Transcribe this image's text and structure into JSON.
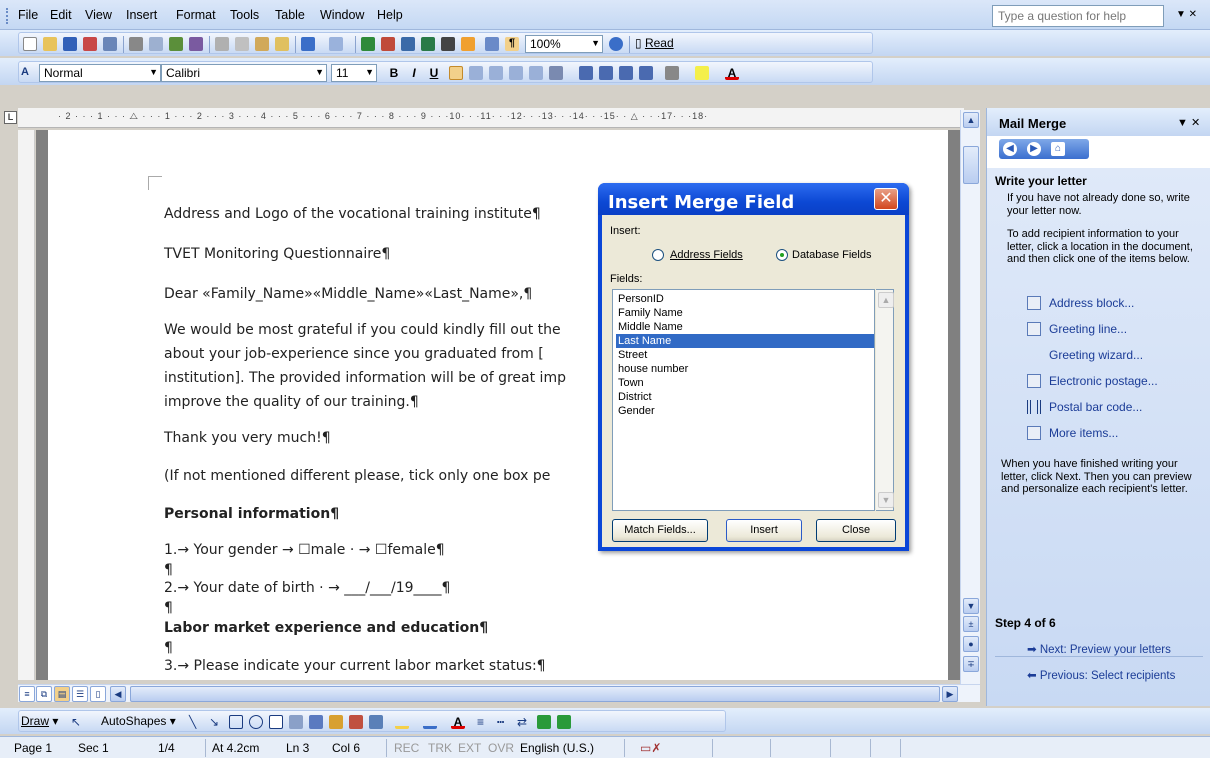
{
  "menu": {
    "items": [
      "File",
      "Edit",
      "View",
      "Insert",
      "Format",
      "Tools",
      "Table",
      "Window",
      "Help"
    ],
    "help_placeholder": "Type a question for help"
  },
  "standard_toolbar": {
    "zoom": "100%",
    "read_label": "Read"
  },
  "formatting_toolbar": {
    "style": "Normal",
    "font": "Calibri",
    "size": "11",
    "bold": "B",
    "italic": "I",
    "underline": "U"
  },
  "ruler": {
    "marks": "· 2 · · · 1 · · · ⧍ · · · 1 · · · 2 · · · 3 · · · 4 · · · 5 · · · 6 · · · 7 · · · 8 · · · 9 · · ·10· · ·11· · ·12· · ·13· · ·14· · ·15· · △ · · ·17· · ·18·",
    "corner": "L"
  },
  "document": {
    "p1": "Address and Logo of the vocational training institute¶",
    "p2": "TVET Monitoring Questionnaire¶",
    "p3": "Dear «Family_Name»«Middle_Name»«Last_Name»,¶",
    "p4a": "We would be most grateful if you could kindly fill out the",
    "p4b": "about your job-experience since you graduated from [",
    "p4c": "institution]. The provided information will be of great imp",
    "p4d": "improve the quality of our training.¶",
    "p5": "Thank you very much!¶",
    "p6": "(If not mentioned different please, tick only one box pe",
    "p7": "Personal information¶",
    "p8": "1.→ Your gender  →  ☐male ·  →  ☐female¶",
    "p9": "¶",
    "p10": "2.→ Your date of birth ·  →   ___/___/19____¶",
    "p11": "¶",
    "p12": "Labor market experience and education¶",
    "p13": "¶",
    "p14": "3.→ Please indicate your current labor market status:¶"
  },
  "dialog": {
    "title": "Insert Merge Field",
    "insert_label": "Insert:",
    "radio_address": "Address Fields",
    "radio_database": "Database Fields",
    "fields_label": "Fields:",
    "fields": [
      "PersonID",
      "Family Name",
      "Middle Name",
      "Last Name",
      "Street",
      "house number",
      "Town",
      "District",
      "Gender"
    ],
    "selected_field": "Last Name",
    "match_button": "Match Fields...",
    "insert_button": "Insert",
    "close_button": "Close"
  },
  "taskpane": {
    "title": "Mail Merge",
    "heading": "Write your letter",
    "text1": "If you have not already done so, write your letter now.",
    "text2": "To add recipient information to your letter, click a location in the document, and then click one of the items below.",
    "links": [
      "Address block...",
      "Greeting line...",
      "Greeting wizard...",
      "Electronic postage...",
      "Postal bar code...",
      "More items..."
    ],
    "text3": "When you have finished writing your letter, click Next. Then you can preview and personalize each recipient's letter.",
    "step": "Step 4 of 6",
    "next": "Next: Preview your letters",
    "prev": "Previous: Select recipients"
  },
  "drawbar": {
    "draw": "Draw",
    "autoshapes": "AutoShapes"
  },
  "status": {
    "page": "Page 1",
    "sec": "Sec 1",
    "pages": "1/4",
    "at": "At 4.2cm",
    "ln": "Ln 3",
    "col": "Col 6",
    "rec": "REC",
    "trk": "TRK",
    "ext": "EXT",
    "ovr": "OVR",
    "lang": "English (U.S.)"
  },
  "colors": {
    "selection": "#316ac5",
    "titlebar": "#0a46d8",
    "link": "#1b3c97"
  }
}
